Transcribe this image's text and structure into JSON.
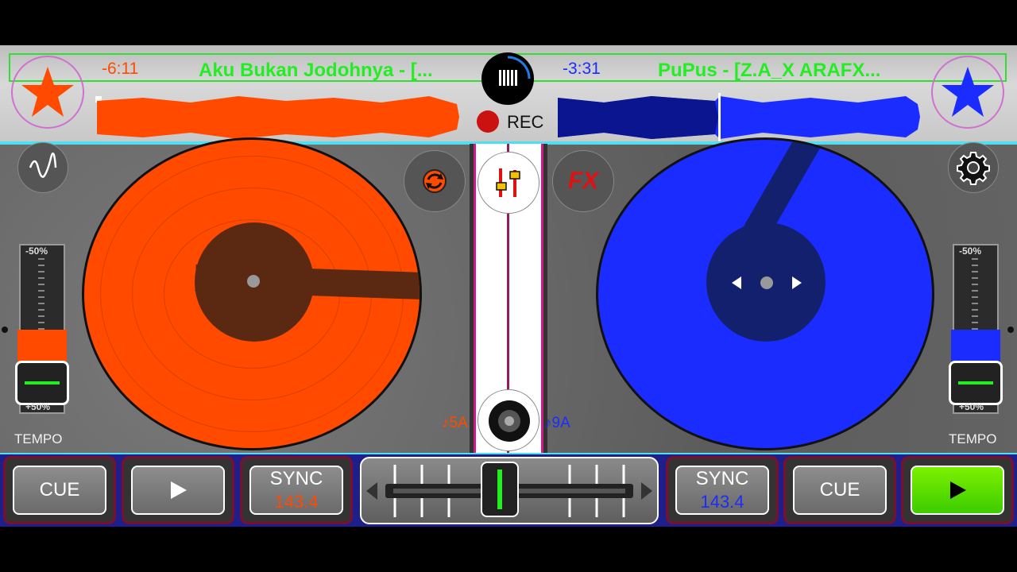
{
  "deck_left": {
    "time": "-6:11",
    "track": "Aku Bukan Jodohnya - [...",
    "key": "♪5A",
    "tempo_label": "TEMPO",
    "pitch_top": "-50%",
    "pitch_bottom": "+50%",
    "cue_label": "CUE",
    "sync_label": "SYNC",
    "bpm": "143.4",
    "color": "#ff4a00"
  },
  "deck_right": {
    "time": "-3:31",
    "track": "PuPus - [Z.A_X ARAFX...",
    "key": "♪9A",
    "tempo_label": "TEMPO",
    "pitch_top": "-50%",
    "pitch_bottom": "+50%",
    "cue_label": "CUE",
    "sync_label": "SYNC",
    "bpm": "143.4",
    "color": "#1a2cff"
  },
  "center": {
    "rec_label": "REC",
    "fx_label": "FX"
  },
  "icons": {
    "left_star": "star-icon",
    "right_star": "star-icon",
    "menu": "bars-icon",
    "wave": "waveform-icon",
    "sync_loop": "loop-icon",
    "mixer": "mixer-icon",
    "settings": "gear-icon",
    "play": "play-icon"
  }
}
